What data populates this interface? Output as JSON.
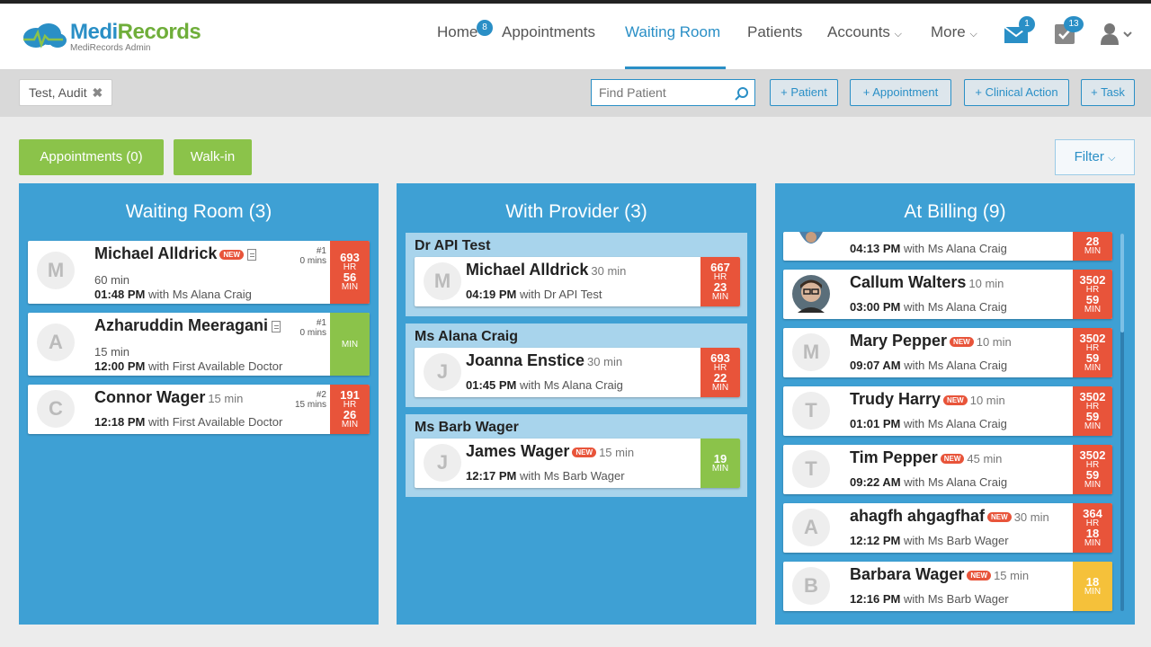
{
  "app": {
    "brand_prefix": "Medi",
    "brand_suffix": "Records",
    "subtitle": "MediRecords Admin"
  },
  "nav": {
    "home": "Home",
    "home_badge": "8",
    "appointments": "Appointments",
    "waiting_room": "Waiting Room",
    "patients": "Patients",
    "accounts": "Accounts",
    "more": "More",
    "mail_badge": "1",
    "tasks_badge": "13"
  },
  "toolbar": {
    "current_patient": "Test, Audit",
    "search_placeholder": "Find Patient",
    "add_patient": "+ Patient",
    "add_appointment": "+ Appointment",
    "add_clinical_action": "+ Clinical Action",
    "add_task": "+ Task"
  },
  "filters": {
    "appointments": "Appointments (0)",
    "walkin": "Walk-in",
    "filter": "Filter"
  },
  "waiting": {
    "title": "Waiting Room (3)",
    "cards": [
      {
        "initial": "M",
        "name": "Michael Alldrick",
        "new": "NEW",
        "line1": "60 min",
        "time": "01:48 PM",
        "with": "with Ms Alana Craig",
        "queue_pos": "#1",
        "queue_wait": "0 mins",
        "timer_top": "693",
        "timer_hr": "HR",
        "timer_min": "56",
        "timer_unit": "MIN"
      },
      {
        "initial": "A",
        "name": "Azharuddin Meeragani",
        "line1": "15 min",
        "time": "12:00 PM",
        "with": "with First Available Doctor",
        "queue_pos": "#1",
        "queue_wait": "0 mins",
        "timer_unit": "MIN"
      },
      {
        "initial": "C",
        "name": "Connor Wager",
        "dur": "15 min",
        "time": "12:18 PM",
        "with": "with First Available Doctor",
        "queue_pos": "#2",
        "queue_wait": "15 mins",
        "timer_top": "191",
        "timer_hr": "HR",
        "timer_min": "26",
        "timer_unit": "MIN"
      }
    ]
  },
  "provider": {
    "title": "With Provider (3)",
    "groups": [
      {
        "doctor": "Dr API Test",
        "initial": "M",
        "name": "Michael Alldrick",
        "dur": "30 min",
        "time": "04:19 PM",
        "with": "with Dr API Test",
        "timer_top": "667",
        "timer_hr": "HR",
        "timer_min": "23",
        "timer_unit": "MIN"
      },
      {
        "doctor": "Ms Alana Craig",
        "initial": "J",
        "name": "Joanna Enstice",
        "dur": "30 min",
        "time": "01:45 PM",
        "with": "with Ms Alana Craig",
        "timer_top": "693",
        "timer_hr": "HR",
        "timer_min": "22",
        "timer_unit": "MIN"
      },
      {
        "doctor": "Ms Barb Wager",
        "initial": "J",
        "name": "James Wager",
        "new": "NEW",
        "dur": "15 min",
        "time": "12:17 PM",
        "with": "with Ms Barb Wager",
        "timer_min": "19",
        "timer_unit": "MIN"
      }
    ]
  },
  "billing": {
    "title": "At Billing (9)",
    "cards": [
      {
        "time": "04:13 PM",
        "with": "with Ms Alana Craig",
        "timer_min": "28",
        "timer_unit": "MIN"
      },
      {
        "name": "Callum Walters",
        "dur": "10 min",
        "time": "03:00 PM",
        "with": "with Ms Alana Craig",
        "timer_top": "3502",
        "timer_hr": "HR",
        "timer_min": "59",
        "timer_unit": "MIN"
      },
      {
        "initial": "M",
        "name": "Mary Pepper",
        "new": "NEW",
        "dur": "10 min",
        "time": "09:07 AM",
        "with": "with Ms Alana Craig",
        "timer_top": "3502",
        "timer_hr": "HR",
        "timer_min": "59",
        "timer_unit": "MIN"
      },
      {
        "initial": "T",
        "name": "Trudy Harry",
        "new": "NEW",
        "dur": "10 min",
        "time": "01:01 PM",
        "with": "with Ms Alana Craig",
        "timer_top": "3502",
        "timer_hr": "HR",
        "timer_min": "59",
        "timer_unit": "MIN"
      },
      {
        "initial": "T",
        "name": "Tim Pepper",
        "new": "NEW",
        "dur": "45 min",
        "time": "09:22 AM",
        "with": "with Ms Alana Craig",
        "timer_top": "3502",
        "timer_hr": "HR",
        "timer_min": "59",
        "timer_unit": "MIN"
      },
      {
        "initial": "A",
        "name": "ahagfh ahgagfhaf",
        "new": "NEW",
        "dur": "30 min",
        "time": "12:12 PM",
        "with": "with Ms Barb Wager",
        "timer_top": "364",
        "timer_hr": "HR",
        "timer_min": "18",
        "timer_unit": "MIN"
      },
      {
        "initial": "B",
        "name": "Barbara Wager",
        "new": "NEW",
        "dur": "15 min",
        "time": "12:16 PM",
        "with": "with Ms Barb Wager",
        "timer_min": "18",
        "timer_unit": "MIN"
      }
    ]
  },
  "colors": {
    "primary": "#3ea0d4",
    "green": "#8bc34a",
    "red": "#e8543a",
    "yellow": "#f5c13a"
  }
}
